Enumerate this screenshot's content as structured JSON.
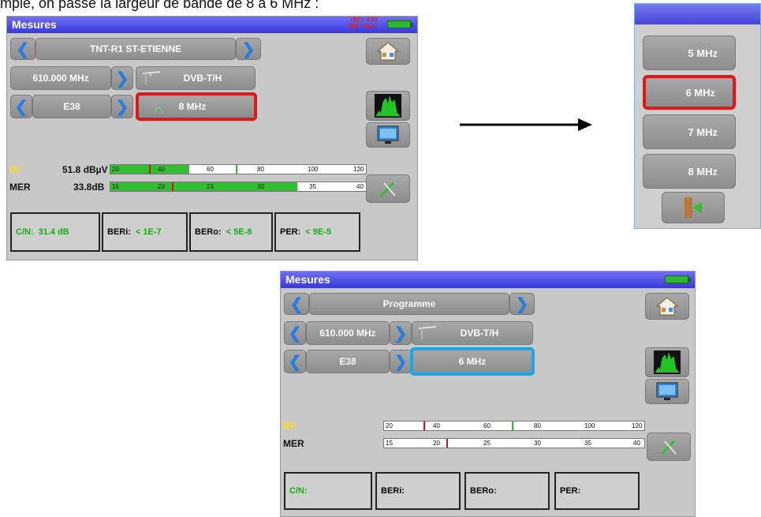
{
  "caption": "mple, on passe la largeur de bande de 8 à 6 MHz :",
  "screen1": {
    "title": "Mesures",
    "vdc": "VDC= 0.0V",
    "idc": "IDC= 0mA",
    "program": "TNT-R1 ST-ETIENNE",
    "freq": "610.000 MHz",
    "standard": "DVB-T/H",
    "channel": "E38",
    "bandwidth": "8 MHz",
    "rf_label": "RF",
    "rf_value": "51.8 dBµV",
    "mer_label": "MER",
    "mer_value": "33.8dB",
    "rf_ticks": [
      "20",
      "40",
      "60",
      "80",
      "100",
      "120"
    ],
    "mer_ticks": [
      "15",
      "20",
      "25",
      "30",
      "35",
      "40"
    ],
    "cn_label": "C/N:",
    "cn_value": "31.4 dB",
    "beri_label": "BERi:",
    "beri_value": "< 1E-7",
    "bero_label": "BERo:",
    "bero_value": "< 5E-8",
    "per_label": "PER:",
    "per_value": "< 9E-5"
  },
  "menu": {
    "options": [
      "5 MHz",
      "6 MHz",
      "7 MHz",
      "8 MHz"
    ],
    "selected": "6 MHz"
  },
  "screen2": {
    "title": "Mesures",
    "program": "Programme",
    "freq": "610.000 MHz",
    "standard": "DVB-T/H",
    "channel": "E38",
    "bandwidth": "6 MHz",
    "rf_label": "RF",
    "mer_label": "MER",
    "rf_ticks": [
      "20",
      "40",
      "60",
      "80",
      "100",
      "120"
    ],
    "mer_ticks": [
      "15",
      "20",
      "25",
      "30",
      "35",
      "40"
    ],
    "cn_label": "C/N:",
    "beri_label": "BERi:",
    "bero_label": "BERo:",
    "per_label": "PER:"
  },
  "colors": {
    "accent_red": "#e01818",
    "accent_blue": "#1aa6e8",
    "green": "#2fbf2f",
    "title_blue": "#4040e0"
  }
}
